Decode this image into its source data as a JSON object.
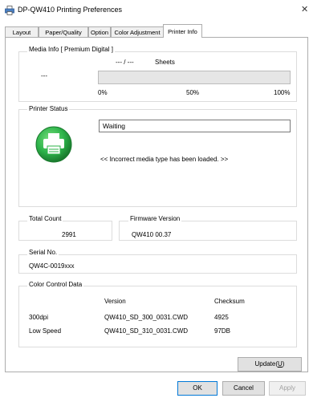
{
  "window": {
    "title": "DP-QW410 Printing Preferences"
  },
  "tabs": [
    {
      "label": "Layout"
    },
    {
      "label": "Paper/Quality"
    },
    {
      "label": "Option"
    },
    {
      "label": "Color Adjustment"
    },
    {
      "label": "Printer Info",
      "active": true
    }
  ],
  "media_info": {
    "legend": "Media Info [ Premium Digital ]",
    "counter": "--- / ---",
    "unit": "Sheets",
    "left_value": "---",
    "progress_value": 0,
    "scale_labels": [
      "0%",
      "50%",
      "100%"
    ]
  },
  "printer_status": {
    "legend": "Printer Status",
    "status": "Waiting",
    "message": "<< Incorrect media type has been loaded. >>",
    "icon": "printer-status-ok-icon",
    "icon_color": "#2db34a"
  },
  "total_count": {
    "legend": "Total Count",
    "value": "2991"
  },
  "firmware": {
    "legend": "Firmware Version",
    "value": "QW410 00.37"
  },
  "serial": {
    "legend": "Serial No.",
    "value": "QW4C-0019xxx"
  },
  "color_control": {
    "legend": "Color Control Data",
    "headers": [
      "",
      "Version",
      "Checksum"
    ],
    "rows": [
      {
        "name": "300dpi",
        "version": "QW410_SD_300_0031.CWD",
        "checksum": "4925"
      },
      {
        "name": "Low Speed",
        "version": "QW410_SD_310_0031.CWD",
        "checksum": "97DB"
      }
    ]
  },
  "buttons": {
    "update": "Update",
    "update_key": "U",
    "ok": "OK",
    "cancel": "Cancel",
    "apply": "Apply"
  }
}
